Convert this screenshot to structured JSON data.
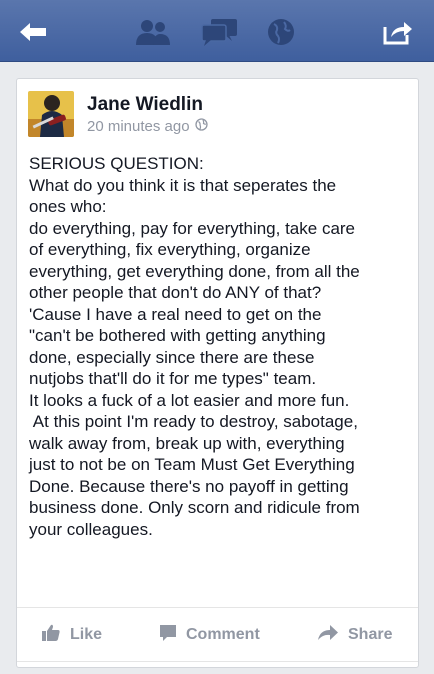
{
  "topbar": {
    "back_icon": "back-arrow-icon",
    "friends_icon": "friend-requests-icon",
    "messages_icon": "messages-icon",
    "globe_icon": "notifications-globe-icon",
    "share_icon": "share-icon",
    "bar_color": "#3f5f9e"
  },
  "post": {
    "author": "Jane Wiedlin",
    "timestamp": "20 minutes ago",
    "privacy_icon": "public-globe-icon",
    "lines": [
      "SERIOUS QUESTION:",
      "What do you think it is that seperates the",
      "ones who:",
      "do everything, pay for everything, take care",
      "of everything, fix everything, organize",
      "everything, get everything done, from all the",
      "other people that don't do ANY of that?",
      "'Cause I have a real need to get on the",
      "\"can't be bothered with getting anything",
      "done, especially since there are these",
      "nutjobs that'll do it for me types\" team.",
      "It looks a fuck of a lot easier and more fun.",
      " At this point I'm ready to destroy, sabotage,",
      "walk away from, break up with, everything",
      "just to not be on Team Must Get Everything",
      "Done. Because there's no payoff in getting",
      "business done. Only scorn and ridicule from",
      "your colleagues."
    ]
  },
  "actions": {
    "like_label": "Like",
    "comment_label": "Comment",
    "share_label": "Share"
  }
}
